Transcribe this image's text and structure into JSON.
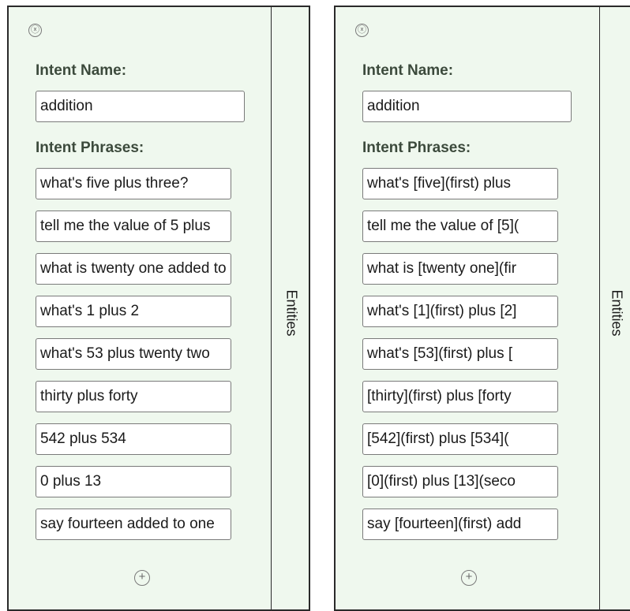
{
  "panels": [
    {
      "close_icon": "ⓧ",
      "intent_name_label": "Intent Name:",
      "intent_name_value": "addition",
      "intent_phrases_label": "Intent Phrases:",
      "phrases": [
        "what's five plus three?",
        "tell me the value of 5 plus",
        "what is twenty one added to",
        "what's 1 plus 2",
        "what's 53 plus twenty two",
        "thirty plus forty",
        "542 plus 534",
        "0 plus 13",
        "say fourteen added to one"
      ],
      "add_icon": "+",
      "entities_tab_label": "Entities"
    },
    {
      "close_icon": "ⓧ",
      "intent_name_label": "Intent Name:",
      "intent_name_value": "addition",
      "intent_phrases_label": "Intent Phrases:",
      "phrases": [
        "what's [five](first) plus",
        "tell me the value of [5](",
        "what is [twenty one](fir",
        "what's [1](first) plus [2]",
        "what's [53](first) plus [",
        "[thirty](first) plus [forty",
        "[542](first) plus [534](",
        "[0](first) plus [13](seco",
        "say [fourteen](first) add"
      ],
      "add_icon": "+",
      "entities_tab_label": "Entities"
    }
  ],
  "colors": {
    "panel_background": "#eff8ee",
    "label_text": "#3c4a3c",
    "border": "#2a2a2a"
  }
}
